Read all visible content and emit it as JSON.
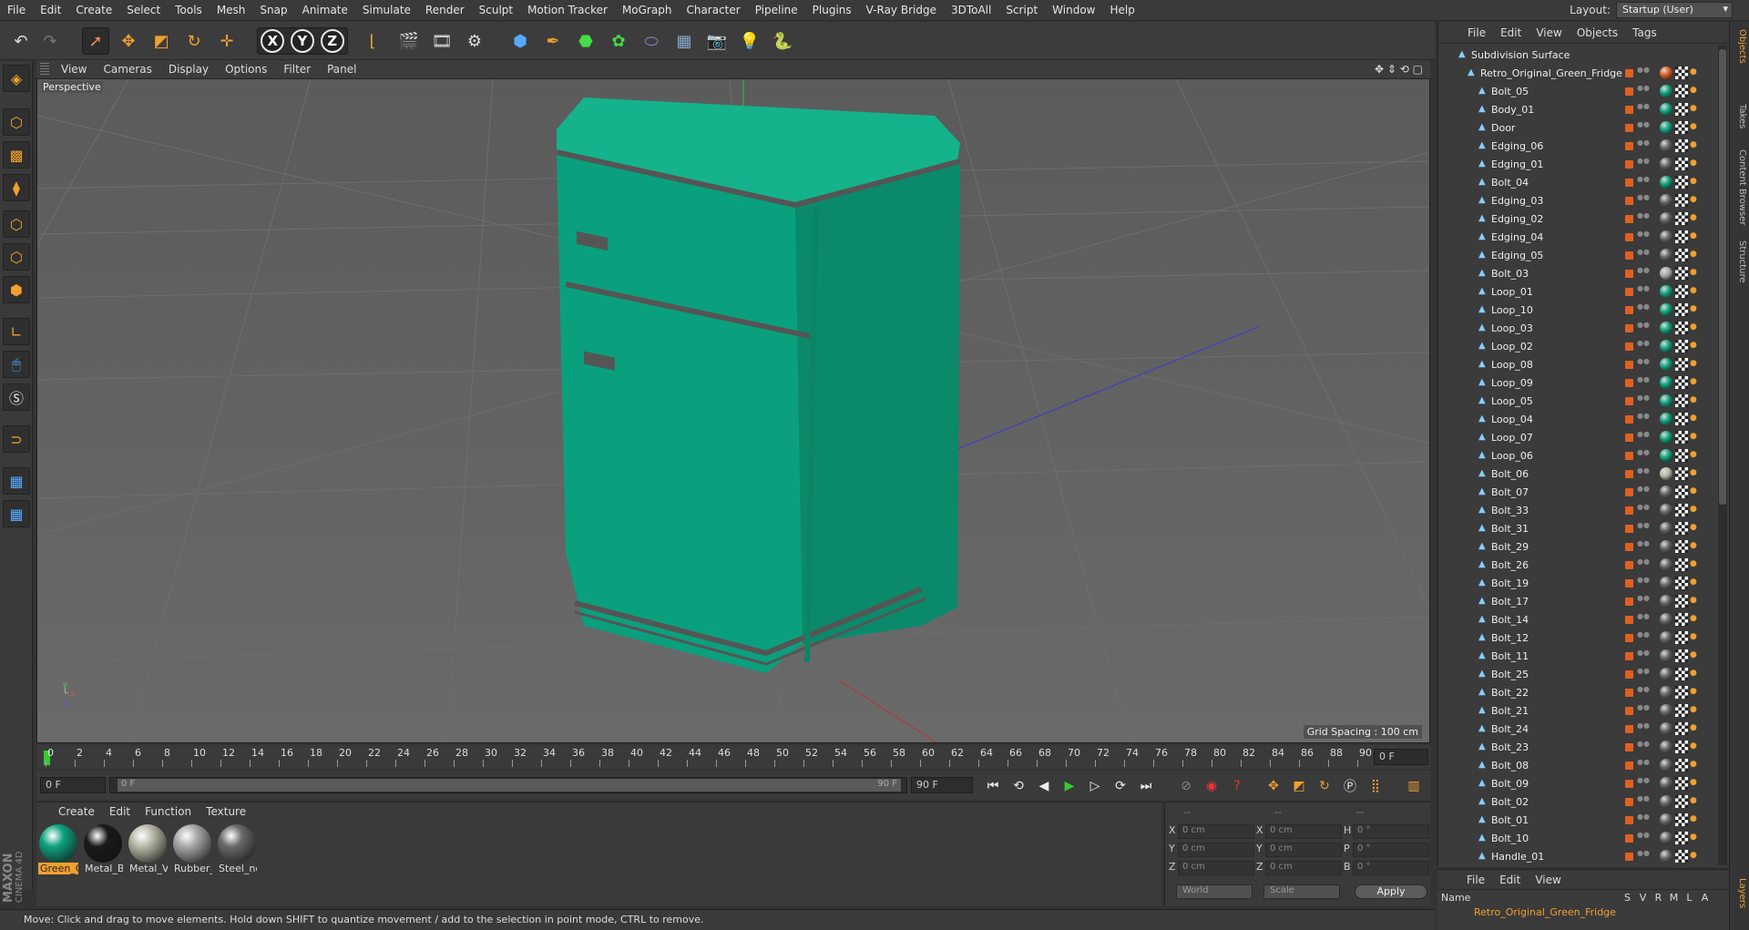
{
  "menu": [
    "File",
    "Edit",
    "Create",
    "Select",
    "Tools",
    "Mesh",
    "Snap",
    "Animate",
    "Simulate",
    "Render",
    "Sculpt",
    "Motion Tracker",
    "MoGraph",
    "Character",
    "Pipeline",
    "Plugins",
    "V-Ray Bridge",
    "3DToAll",
    "Script",
    "Window",
    "Help"
  ],
  "layout": {
    "label": "Layout:",
    "value": "Startup (User)"
  },
  "toolbar_icons": [
    "undo-icon",
    "redo-icon",
    "select-arrow-icon",
    "move-icon",
    "scale-icon",
    "rotate-icon",
    "live-select-icon",
    "x-axis-icon",
    "y-axis-icon",
    "z-axis-icon",
    "coordinate-system-icon",
    "render-view-icon",
    "render-picture-viewer-icon",
    "edit-render-settings-icon",
    "cube-icon",
    "pen-icon",
    "subdivision-icon",
    "mograph-cloner-icon",
    "deformer-icon",
    "floor-icon",
    "camera-icon",
    "light-icon",
    "python-icon"
  ],
  "axes": {
    "x": "X",
    "y": "Y",
    "z": "Z"
  },
  "viewport": {
    "menu": [
      "View",
      "Cameras",
      "Display",
      "Options",
      "Filter",
      "Panel"
    ],
    "label": "Perspective",
    "grid_spacing": "Grid Spacing : 100 cm"
  },
  "timeline": {
    "ticks": [
      "0",
      "2",
      "4",
      "6",
      "8",
      "10",
      "12",
      "14",
      "16",
      "18",
      "20",
      "22",
      "24",
      "26",
      "28",
      "30",
      "32",
      "34",
      "36",
      "38",
      "40",
      "42",
      "44",
      "46",
      "48",
      "50",
      "52",
      "54",
      "56",
      "58",
      "60",
      "62",
      "64",
      "66",
      "68",
      "70",
      "72",
      "74",
      "76",
      "78",
      "80",
      "82",
      "84",
      "86",
      "88",
      "90"
    ],
    "current_frame": "0 F",
    "start_field": "0 F",
    "range_start": "0 F",
    "range_end": "90 F",
    "end_field": "90 F"
  },
  "materials": {
    "menu": [
      "Create",
      "Edit",
      "Function",
      "Texture"
    ],
    "items": [
      {
        "label": "Green_C",
        "color": "#0fa37f"
      },
      {
        "label": "Metal_B",
        "color": "#1a1a1a"
      },
      {
        "label": "Metal_V",
        "color": "#b9b9a8"
      },
      {
        "label": "Rubber_",
        "color": "#a9a9a9"
      },
      {
        "label": "Steel_ne",
        "color": "#6a6a6a"
      }
    ]
  },
  "coordinates": {
    "header": [
      "--",
      "--",
      "--"
    ],
    "rows": [
      {
        "a": "X",
        "av": "0 cm",
        "b": "X",
        "bv": "0 cm",
        "c": "H",
        "cv": "0 °"
      },
      {
        "a": "Y",
        "av": "0 cm",
        "b": "Y",
        "bv": "0 cm",
        "c": "P",
        "cv": "0 °"
      },
      {
        "a": "Z",
        "av": "0 cm",
        "b": "Z",
        "bv": "0 cm",
        "c": "B",
        "cv": "0 °"
      }
    ],
    "mode1": "World",
    "mode2": "Scale",
    "apply": "Apply"
  },
  "status": "Move: Click and drag to move elements. Hold down SHIFT to quantize movement / add to the selection in point mode, CTRL to remove.",
  "brand": {
    "maxon": "MAXON",
    "product": "CINEMA 4D"
  },
  "objects": {
    "menu": [
      "File",
      "Edit",
      "View",
      "Objects",
      "Tags"
    ],
    "root": "Subdivision Surface",
    "group": "Retro_Original_Green_Fridge",
    "items": [
      {
        "name": "Bolt_05",
        "mat": "#0fa37f"
      },
      {
        "name": "Body_01",
        "mat": "#0fa37f"
      },
      {
        "name": "Door",
        "mat": "#0fa37f"
      },
      {
        "name": "Edging_06",
        "mat": "#666"
      },
      {
        "name": "Edging_01",
        "mat": "#666"
      },
      {
        "name": "Bolt_04",
        "mat": "#0fa37f"
      },
      {
        "name": "Edging_03",
        "mat": "#666"
      },
      {
        "name": "Edging_02",
        "mat": "#666"
      },
      {
        "name": "Edging_04",
        "mat": "#666"
      },
      {
        "name": "Edging_05",
        "mat": "#666"
      },
      {
        "name": "Bolt_03",
        "mat": "#aaa"
      },
      {
        "name": "Loop_01",
        "mat": "#0fa37f"
      },
      {
        "name": "Loop_10",
        "mat": "#0fa37f"
      },
      {
        "name": "Loop_03",
        "mat": "#0fa37f"
      },
      {
        "name": "Loop_02",
        "mat": "#0fa37f"
      },
      {
        "name": "Loop_08",
        "mat": "#0fa37f"
      },
      {
        "name": "Loop_09",
        "mat": "#0fa37f"
      },
      {
        "name": "Loop_05",
        "mat": "#0fa37f"
      },
      {
        "name": "Loop_04",
        "mat": "#0fa37f"
      },
      {
        "name": "Loop_07",
        "mat": "#0fa37f"
      },
      {
        "name": "Loop_06",
        "mat": "#0fa37f"
      },
      {
        "name": "Bolt_06",
        "mat": "#b9b9a8"
      },
      {
        "name": "Bolt_07",
        "mat": "#666"
      },
      {
        "name": "Bolt_33",
        "mat": "#666"
      },
      {
        "name": "Bolt_31",
        "mat": "#666"
      },
      {
        "name": "Bolt_29",
        "mat": "#666"
      },
      {
        "name": "Bolt_26",
        "mat": "#666"
      },
      {
        "name": "Bolt_19",
        "mat": "#666"
      },
      {
        "name": "Bolt_17",
        "mat": "#666"
      },
      {
        "name": "Bolt_14",
        "mat": "#666"
      },
      {
        "name": "Bolt_12",
        "mat": "#666"
      },
      {
        "name": "Bolt_11",
        "mat": "#666"
      },
      {
        "name": "Bolt_25",
        "mat": "#666"
      },
      {
        "name": "Bolt_22",
        "mat": "#666"
      },
      {
        "name": "Bolt_21",
        "mat": "#666"
      },
      {
        "name": "Bolt_24",
        "mat": "#666"
      },
      {
        "name": "Bolt_23",
        "mat": "#666"
      },
      {
        "name": "Bolt_08",
        "mat": "#666"
      },
      {
        "name": "Bolt_09",
        "mat": "#666"
      },
      {
        "name": "Bolt_02",
        "mat": "#666"
      },
      {
        "name": "Bolt_01",
        "mat": "#666"
      },
      {
        "name": "Bolt_10",
        "mat": "#666"
      },
      {
        "name": "Handle_01",
        "mat": "#666"
      }
    ]
  },
  "layers": {
    "menu": [
      "File",
      "Edit",
      "View"
    ],
    "columns": [
      "Name",
      "S",
      "V",
      "R",
      "M",
      "L",
      "A"
    ],
    "row": "Retro_Original_Green_Fridge"
  },
  "side_tabs": [
    "Objects",
    "Takes",
    "Content Browser",
    "Structure",
    "Layers"
  ]
}
